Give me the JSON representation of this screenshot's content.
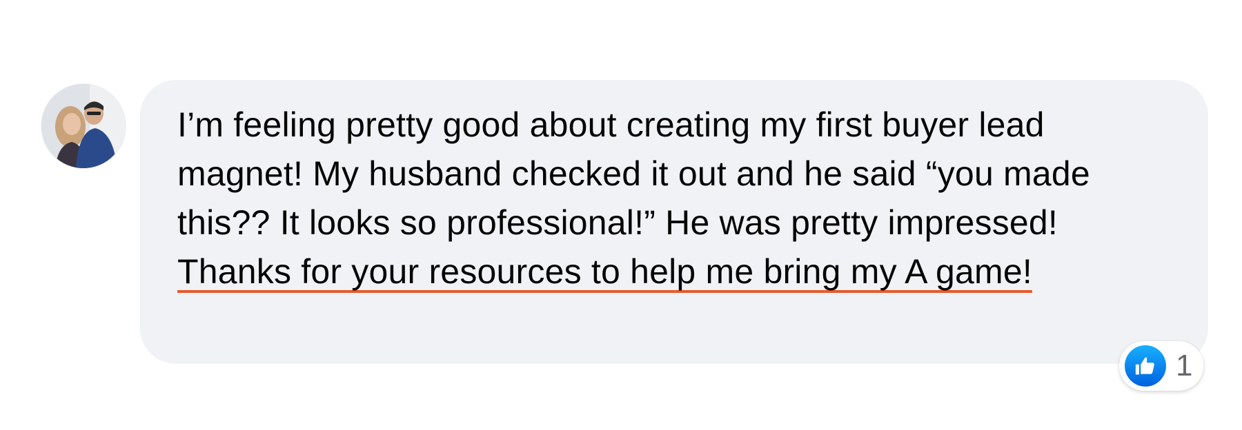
{
  "comment": {
    "author_avatar_alt": "",
    "text_plain": "I’m feeling pretty good about creating my first buyer lead magnet! My husband checked it out and he said “you made this?? It looks so professional!” He was pretty impressed! ",
    "text_highlighted": "Thanks for your resources to help me bring my A game!"
  },
  "reactions": {
    "icon": "thumbs-up-icon",
    "count": "1"
  },
  "colors": {
    "bubble_bg": "#f0f2f5",
    "underline": "#e8592a",
    "like_blue": "#1877f2",
    "count_gray": "#65676b"
  }
}
